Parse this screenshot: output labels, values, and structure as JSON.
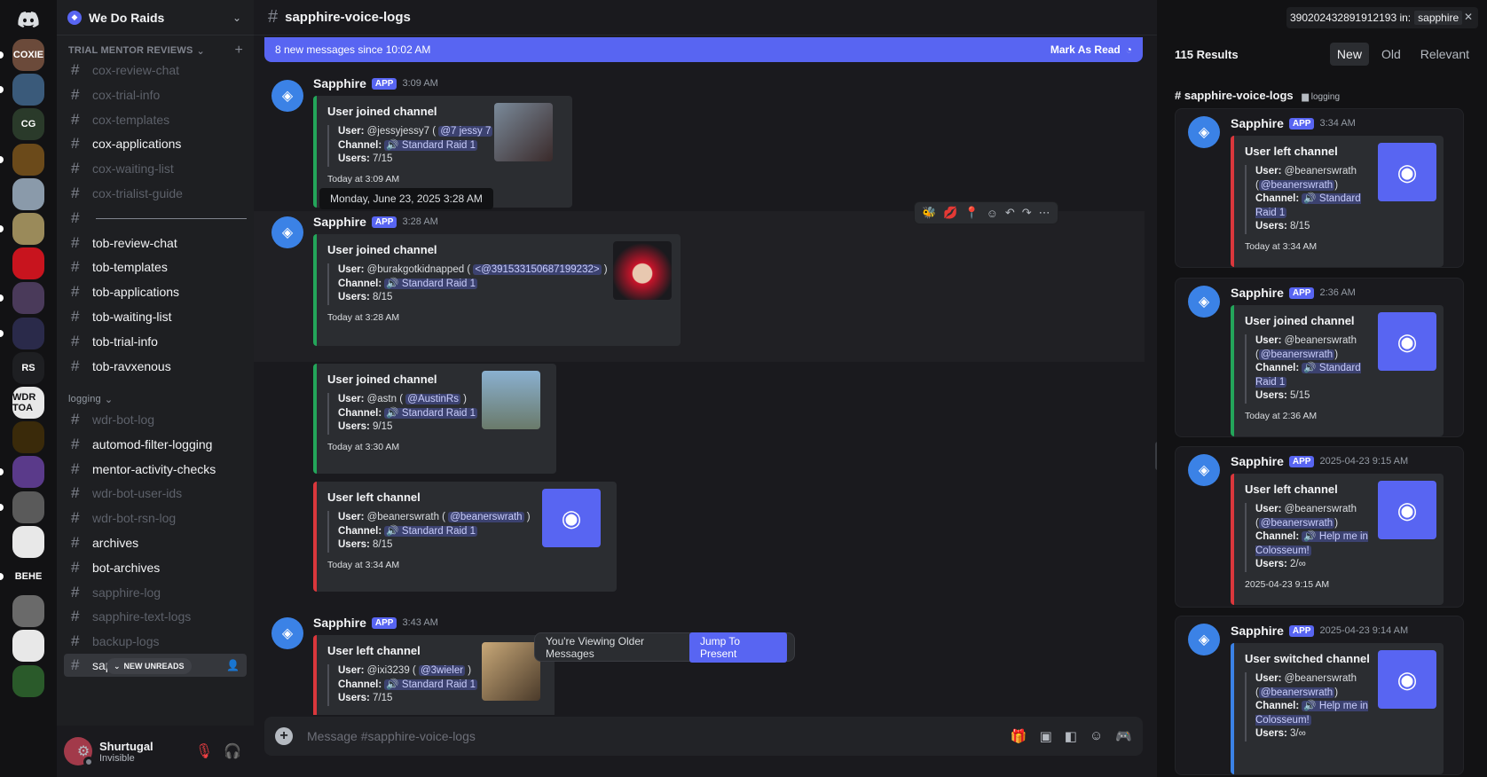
{
  "guild": {
    "name": "We Do Raids"
  },
  "rail": {
    "servers": [
      {
        "label": "COXIE",
        "color": "#6b4a3a",
        "pill": true
      },
      {
        "label": "",
        "color": "#3a5a7a",
        "pill": true
      },
      {
        "label": "CG",
        "color": "#2a3a2a",
        "pill": false
      },
      {
        "label": "",
        "color": "#6b4a1a",
        "pill": true
      },
      {
        "label": "",
        "color": "#8a9aaa",
        "pill": false
      },
      {
        "label": "",
        "color": "#9a8a5a",
        "pill": true
      },
      {
        "label": "",
        "color": "#c8141e",
        "pill": false
      },
      {
        "label": "",
        "color": "#4a3a5a",
        "pill": true
      },
      {
        "label": "",
        "color": "#2a2a4a",
        "pill": true
      },
      {
        "label": "RS",
        "color": "#1e1f22",
        "pill": false
      },
      {
        "label": "WDR TOA",
        "color": "#e8e8e8",
        "pill": false
      },
      {
        "label": "",
        "color": "#3a2a0a",
        "pill": false
      },
      {
        "label": "",
        "color": "#5a3a8a",
        "pill": true
      },
      {
        "label": "",
        "color": "#5a5a5a",
        "pill": true
      },
      {
        "label": "",
        "color": "#e8e8e8",
        "pill": false
      },
      {
        "label": "BEHE",
        "color": "#121214",
        "pill": true
      },
      {
        "label": "",
        "color": "#6a6a6a",
        "pill": false
      },
      {
        "label": "",
        "color": "#e8e8e8",
        "pill": false
      },
      {
        "label": "",
        "color": "#2a5a2a",
        "pill": false
      }
    ]
  },
  "sidebar": {
    "category_trial": "TRIAL MENTOR REVIEWS",
    "category_logging": "logging",
    "new_unreads": "NEW UNREADS",
    "channels_trial": [
      {
        "name": "cox-review-chat",
        "state": "muted"
      },
      {
        "name": "cox-trial-info",
        "state": "muted"
      },
      {
        "name": "cox-templates",
        "state": "muted"
      },
      {
        "name": "cox-applications",
        "state": "normal"
      },
      {
        "name": "cox-waiting-list",
        "state": "muted"
      },
      {
        "name": "cox-trialist-guide",
        "state": "muted"
      },
      {
        "name": "",
        "state": "divider"
      },
      {
        "name": "tob-review-chat",
        "state": "normal"
      },
      {
        "name": "tob-templates",
        "state": "normal"
      },
      {
        "name": "tob-applications",
        "state": "normal"
      },
      {
        "name": "tob-waiting-list",
        "state": "normal"
      },
      {
        "name": "tob-trial-info",
        "state": "normal"
      },
      {
        "name": "tob-ravxenous",
        "state": "normal"
      }
    ],
    "channels_logging": [
      {
        "name": "wdr-bot-log",
        "state": "muted"
      },
      {
        "name": "automod-filter-logging",
        "state": "normal"
      },
      {
        "name": "mentor-activity-checks",
        "state": "normal"
      },
      {
        "name": "wdr-bot-user-ids",
        "state": "muted"
      },
      {
        "name": "wdr-bot-rsn-log",
        "state": "muted"
      },
      {
        "name": "archives",
        "state": "normal"
      },
      {
        "name": "bot-archives",
        "state": "normal"
      },
      {
        "name": "sapphire-log",
        "state": "muted"
      },
      {
        "name": "sapphire-text-logs",
        "state": "muted"
      },
      {
        "name": "backup-logs",
        "state": "muted"
      }
    ],
    "selected_channel": "sapp"
  },
  "user": {
    "name": "Shurtugal",
    "status": "Invisible"
  },
  "chat": {
    "channel": "sapphire-voice-logs",
    "banner_text": "8 new messages since 10:02 AM",
    "banner_action": "Mark As Read",
    "tooltip": "Monday, June 23, 2025 3:28 AM",
    "older_text": "You're Viewing Older Messages",
    "jump_label": "Jump To Present",
    "composer_placeholder": "Message #sapphire-voice-logs",
    "messages": [
      {
        "author": "Sapphire",
        "tag": "APP",
        "time": "3:09 AM",
        "title": "User joined channel",
        "user": "@jessyjessy7",
        "mention": "@7 jessy 7",
        "channel": "Standard Raid 1",
        "users": "7/15",
        "footer": "Today at 3:09 AM"
      },
      {
        "author": "Sapphire",
        "tag": "APP",
        "time": "3:28 AM",
        "title": "User joined channel",
        "user": "@burakgotkidnapped",
        "mention": "<@391533150687199232>",
        "channel": "Standard Raid 1",
        "users": "8/15",
        "footer": "Today at 3:28 AM"
      },
      {
        "title": "User joined channel",
        "user": "@astn",
        "mention": "@AustinRs",
        "channel": "Standard Raid 1",
        "users": "9/15",
        "footer": "Today at 3:30 AM"
      },
      {
        "title": "User left channel",
        "user": "@beanerswrath",
        "mention": "@beanerswrath",
        "channel": "Standard Raid 1",
        "users": "8/15",
        "footer": "Today at 3:34 AM"
      },
      {
        "author": "Sapphire",
        "tag": "APP",
        "time": "3:43 AM",
        "title": "User left channel",
        "user": "@ixi3239",
        "mention": "@3wieler",
        "channel": "Standard Raid 1",
        "users": "7/15",
        "footer": ""
      }
    ]
  },
  "labels": {
    "user": "User:",
    "channel": "Channel:",
    "users": "Users:"
  },
  "search": {
    "query": "390202432891912193 in:",
    "token": "sapphire",
    "results_count": "115 Results",
    "tabs": [
      "New",
      "Old",
      "Relevant"
    ],
    "channel": "sapphire-voice-logs",
    "category": "logging",
    "results": [
      {
        "author": "Sapphire",
        "tag": "APP",
        "time": "3:34 AM",
        "title": "User left channel",
        "user": "@beanerswrath",
        "mention": "@beanerswrath",
        "channel": "Standard Raid 1",
        "users": "8/15",
        "footer": "Today at 3:34 AM"
      },
      {
        "author": "Sapphire",
        "tag": "APP",
        "time": "2:36 AM",
        "title": "User joined channel",
        "user": "@beanerswrath",
        "mention": "@beanerswrath",
        "channel": "Standard Raid 1",
        "users": "5/15",
        "footer": "Today at 2:36 AM"
      },
      {
        "author": "Sapphire",
        "tag": "APP",
        "time": "2025-04-23 9:15 AM",
        "title": "User left channel",
        "user": "@beanerswrath",
        "mention": "@beanerswrath",
        "channel": "Help me in Colosseum!",
        "users": "2/∞",
        "footer": "2025-04-23 9:15 AM"
      },
      {
        "author": "Sapphire",
        "tag": "APP",
        "time": "2025-04-23 9:14 AM",
        "title": "User switched channel",
        "user": "@beanerswrath",
        "mention": "@beanerswrath",
        "channel": "Help me in Colosseum!",
        "users": "3/∞",
        "footer": ""
      }
    ]
  }
}
